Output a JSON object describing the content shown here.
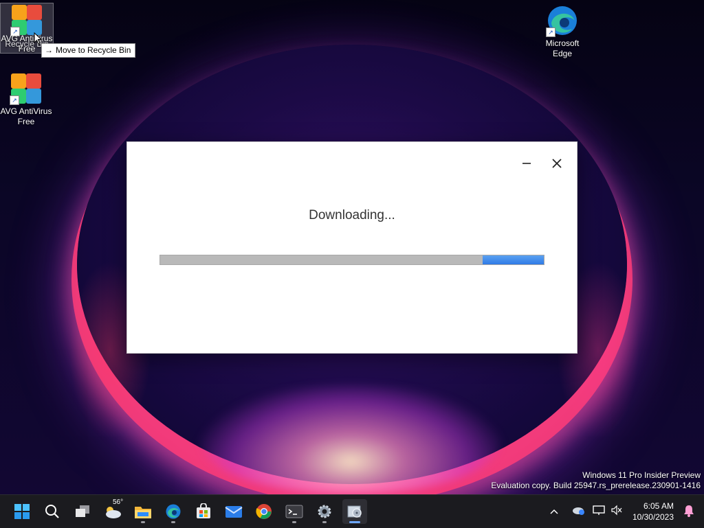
{
  "desktop": {
    "icons": [
      {
        "label": "AVG AntiVirus Free",
        "overlay_label": "Recycle Bin"
      },
      {
        "label": "AVG AntiVirus Free"
      },
      {
        "label": "Microsoft Edge"
      }
    ],
    "tooltip": "Move to Recycle Bin"
  },
  "dialog": {
    "title": "Downloading...",
    "progress_fraction": 0.16,
    "progress_color": "#2f7ae6",
    "minimize_icon": "minimize-icon",
    "close_icon": "close-icon"
  },
  "watermark": {
    "line1": "Windows 11 Pro Insider Preview",
    "line2": "Evaluation copy. Build 25947.rs_prerelease.230901-1416"
  },
  "taskbar": {
    "weather_temp": "56°",
    "apps": [
      "start-icon",
      "search-icon",
      "task-view-icon",
      "weather-icon",
      "file-explorer-icon",
      "edge-icon",
      "store-icon",
      "mail-icon",
      "chrome-icon",
      "terminal-icon",
      "settings-icon",
      "setup-icon"
    ],
    "clock_time": "6:05 AM",
    "clock_date": "10/30/2023"
  }
}
